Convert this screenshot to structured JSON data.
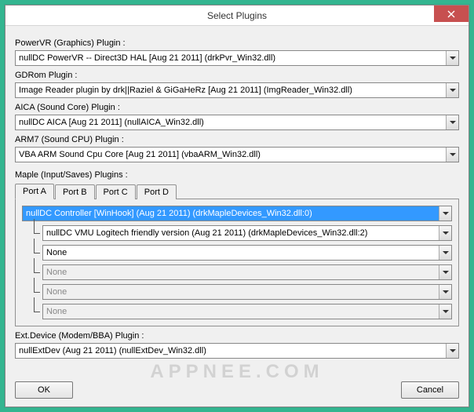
{
  "window": {
    "title": "Select Plugins"
  },
  "labels": {
    "powervr": "PowerVR (Graphics) Plugin :",
    "gdrom": "GDRom Plugin :",
    "aica": "AICA (Sound Core) Plugin :",
    "arm7": "ARM7 (Sound CPU) Plugin :",
    "maple": "Maple (Input/Saves) Plugins :",
    "extdev": "Ext.Device (Modem/BBA) Plugin :"
  },
  "values": {
    "powervr": "nullDC PowerVR -- Direct3D HAL [Aug 21 2011] (drkPvr_Win32.dll)",
    "gdrom": "Image Reader plugin by drk||Raziel & GiGaHeRz [Aug 21 2011] (ImgReader_Win32.dll)",
    "aica": "nullDC AICA [Aug 21 2011] (nullAICA_Win32.dll)",
    "arm7": "VBA ARM Sound Cpu Core [Aug 21 2011] (vbaARM_Win32.dll)",
    "extdev": "nullExtDev (Aug 21 2011) (nullExtDev_Win32.dll)"
  },
  "tabs": {
    "a": "Port A",
    "b": "Port B",
    "c": "Port C",
    "d": "Port D"
  },
  "maple_port_a": {
    "slot0": "nullDC Controller [WinHook] (Aug 21 2011) (drkMapleDevices_Win32.dll:0)",
    "slot1": "nullDC VMU Logitech friendly version (Aug 21 2011) (drkMapleDevices_Win32.dll:2)",
    "slot2": "None",
    "slot3": "None",
    "slot4": "None",
    "slot5": "None"
  },
  "buttons": {
    "ok": "OK",
    "cancel": "Cancel"
  },
  "watermark": "APPNEE.COM"
}
